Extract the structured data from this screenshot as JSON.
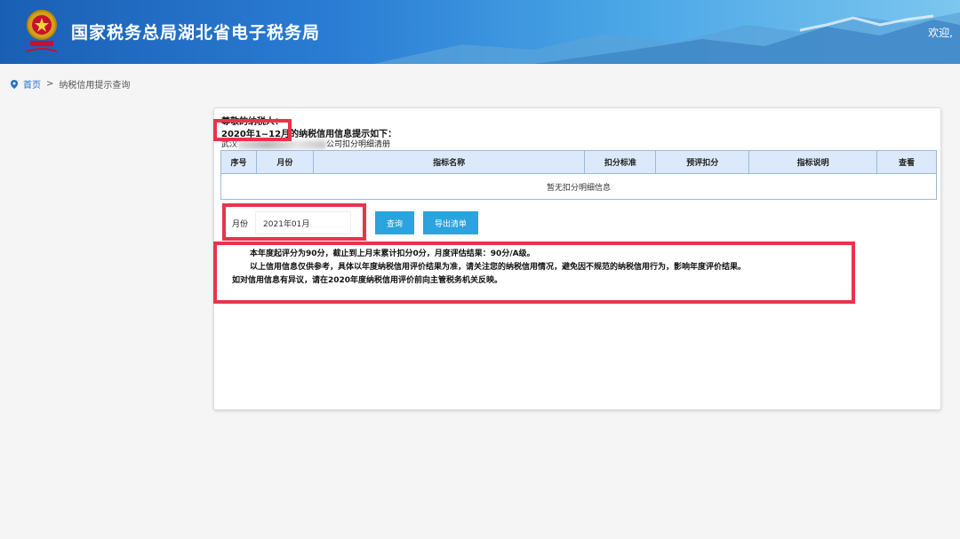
{
  "header": {
    "title": "国家税务总局湖北省电子税务局",
    "welcome": "欢迎,"
  },
  "breadcrumb": {
    "home": "首页",
    "separator": ">",
    "current": "纳税信用提示查询"
  },
  "notice": {
    "greeting": "尊敬的纳税人：",
    "period_prefix": "2020年1~12月",
    "period_suffix": "的纳税信用信息提示如下：",
    "company_prefix": "武汉",
    "company_suffix": "公司扣分明细清册"
  },
  "table": {
    "columns": [
      "序号",
      "月份",
      "指标名称",
      "扣分标准",
      "预评扣分",
      "指标说明",
      "查看"
    ],
    "empty_text": "暂无扣分明细信息"
  },
  "query": {
    "month_label": "月份",
    "month_value": "2021年01月",
    "query_button": "查询",
    "export_button": "导出清单"
  },
  "notes": {
    "line1": "本年度起评分为90分，截止到上月末累计扣分0分，月度评估结果：90分/A级。",
    "line2": "以上信用信息仅供参考，具体以年度纳税信用评价结果为准，请关注您的纳税信用情况，避免因不规范的纳税信用行为，影响年度评价结果。",
    "line3": "如对信用信息有异议，请在2020年度纳税信用评价前向主管税务机关反映。"
  },
  "colors": {
    "header_primary": "#1a5fb4",
    "button": "#2aa3df",
    "highlight": "#e8344a",
    "table_header": "#dbe9fb"
  }
}
